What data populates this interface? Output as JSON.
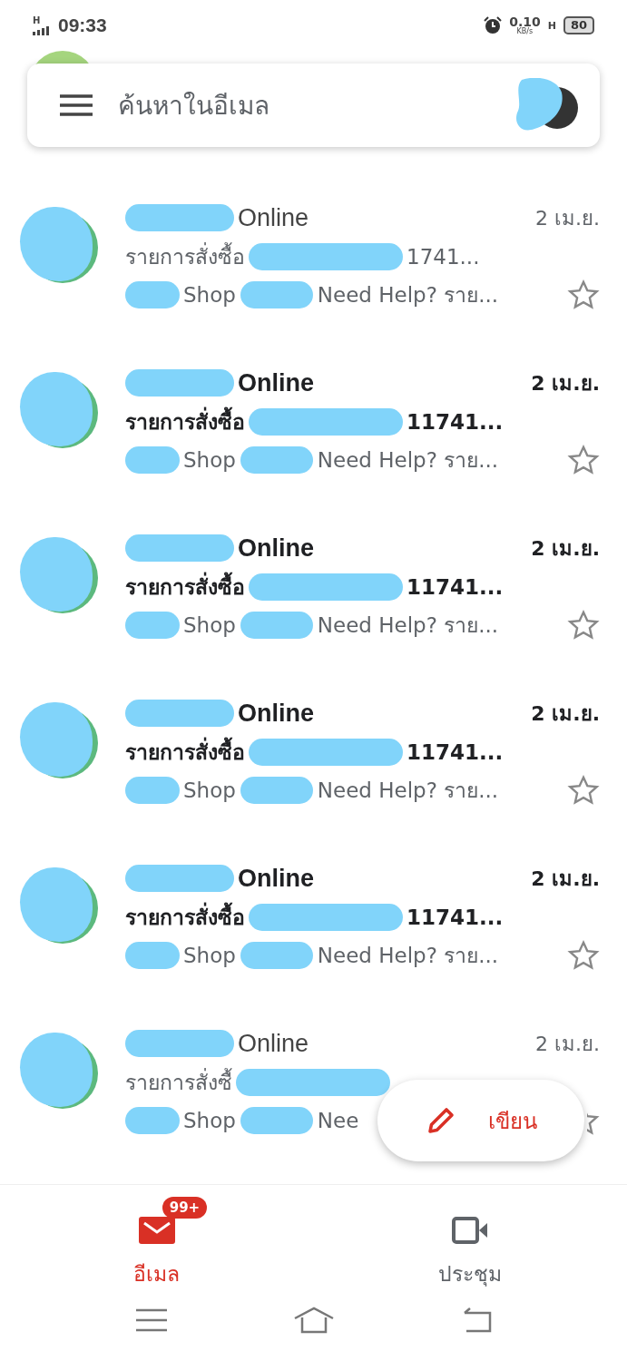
{
  "status_bar": {
    "network": "H",
    "time": "09:33",
    "speed": "0.10",
    "speed_unit": "KB/s",
    "data_network": "H",
    "battery": "80"
  },
  "search": {
    "placeholder": "ค้นหาในอีเมล"
  },
  "emails": [
    {
      "sender": "Online",
      "date": "2 เม.ย.",
      "subject": "รายการสั่งซื้อ",
      "subject_end": "1741...",
      "snippet": "Shop",
      "snippet_end": "Need Help? ราย...",
      "unread": false
    },
    {
      "sender": "Online",
      "date": "2 เม.ย.",
      "subject": "รายการสั่งซื้อ",
      "subject_end": "11741...",
      "snippet": "Shop",
      "snippet_end": "Need Help? ราย...",
      "unread": true
    },
    {
      "sender": "Online",
      "date": "2 เม.ย.",
      "subject": "รายการสั่งซื้อ",
      "subject_end": "11741...",
      "snippet": "Shop",
      "snippet_end": "Need Help? ราย...",
      "unread": true
    },
    {
      "sender": "Online",
      "date": "2 เม.ย.",
      "subject": "รายการสั่งซื้อ",
      "subject_end": "11741...",
      "snippet": "Shop",
      "snippet_end": "Need Help? ราย...",
      "unread": true
    },
    {
      "sender": "Online",
      "date": "2 เม.ย.",
      "subject": "รายการสั่งซื้อ",
      "subject_end": "11741...",
      "snippet": "Shop",
      "snippet_end": "Need Help? ราย...",
      "unread": true
    },
    {
      "sender": "Online",
      "date": "2 เม.ย.",
      "subject": "รายการสั่งซื้",
      "snippet": "Shop",
      "snippet_end": "Nee",
      "unread": false
    }
  ],
  "compose": {
    "label": "เขียน"
  },
  "bottom_nav": [
    {
      "kind": "mail",
      "label": "อีเมล",
      "badge": "99+",
      "selected": true
    },
    {
      "kind": "meet",
      "label": "ประชุม",
      "selected": false
    }
  ]
}
